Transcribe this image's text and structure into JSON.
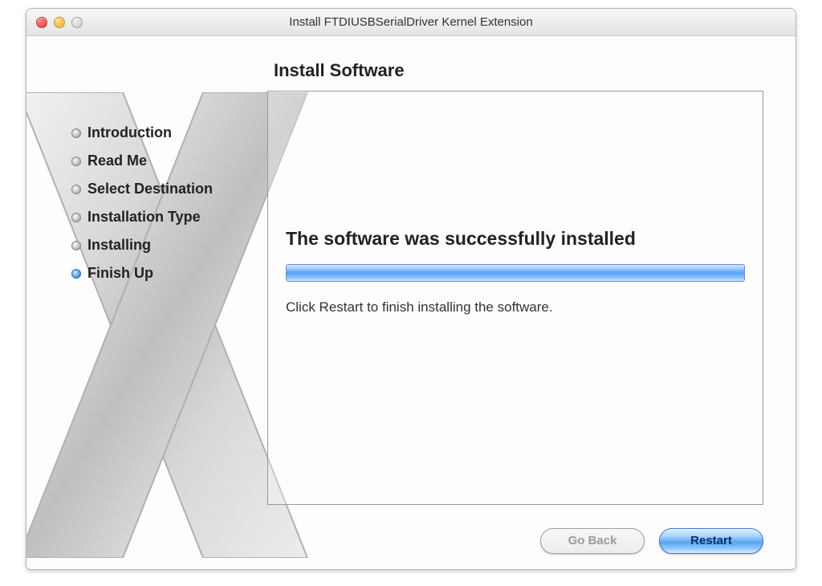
{
  "window_title": "Install FTDIUSBSerialDriver Kernel Extension",
  "section_title": "Install Software",
  "steps": [
    {
      "label": "Introduction",
      "active": false
    },
    {
      "label": "Read Me",
      "active": false
    },
    {
      "label": "Select Destination",
      "active": false
    },
    {
      "label": "Installation Type",
      "active": false
    },
    {
      "label": "Installing",
      "active": false
    },
    {
      "label": "Finish Up",
      "active": true
    }
  ],
  "message": {
    "headline": "The software was successfully installed",
    "hint": "Click Restart to finish installing the software."
  },
  "progress_percent": 100,
  "buttons": {
    "go_back": "Go Back",
    "restart": "Restart"
  }
}
